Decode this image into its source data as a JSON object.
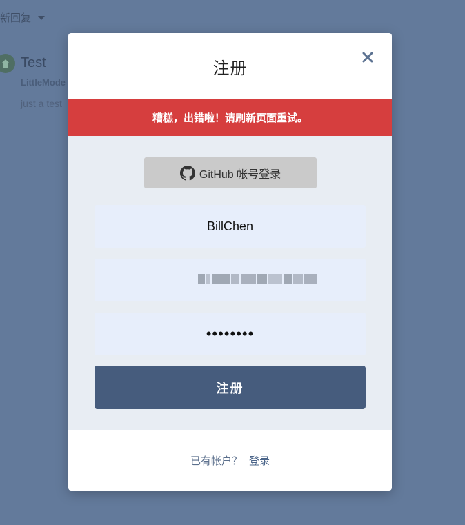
{
  "background": {
    "sort_label": "新回复",
    "post": {
      "title": "Test",
      "author": "LittleMode",
      "snippet": "just a test"
    }
  },
  "modal": {
    "title": "注册",
    "close_icon": "close-icon",
    "error_message": "糟糕，出错啦！请刷新页面重试。",
    "github_button_label": "GitHub 帐号登录",
    "username_value": "BillChen",
    "password_value": "••••••••",
    "submit_label": "注册",
    "footer_text": "已有帐户？",
    "footer_link": "登录"
  },
  "colors": {
    "overlay": "#637a9b",
    "error": "#d63e3e",
    "primary": "#465c7d",
    "form_bg": "#e8edf3",
    "input_bg": "#e7eefb"
  }
}
